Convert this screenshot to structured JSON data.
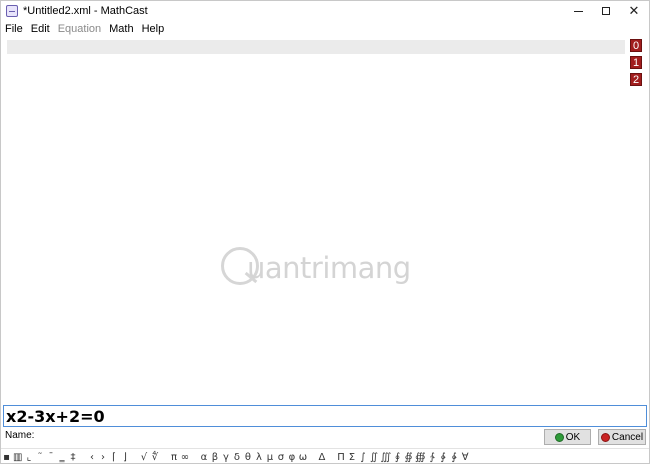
{
  "window": {
    "title": "*Untitled2.xml - MathCast",
    "controls": {
      "minimize_icon": "minimize-icon",
      "maximize_icon": "maximize-icon",
      "close_icon": "close-icon"
    }
  },
  "menubar": {
    "items": [
      {
        "label": "File",
        "enabled": true
      },
      {
        "label": "Edit",
        "enabled": true
      },
      {
        "label": "Equation",
        "enabled": false
      },
      {
        "label": "Math",
        "enabled": true
      },
      {
        "label": "Help",
        "enabled": true
      }
    ]
  },
  "canvas": {
    "line_numbers": [
      "0",
      "1",
      "2"
    ],
    "badge_color": "#a11d1d",
    "watermark_text": "uantrimang"
  },
  "editor": {
    "equation_value": "x2-3x+2=0",
    "name_label": "Name:",
    "ok_label": "OK",
    "cancel_label": "Cancel",
    "accent_color": "#4f8ed9"
  },
  "symbol_bar": {
    "symbols": [
      "▪",
      "▥",
      "⌞",
      "˜",
      "¯",
      "‗",
      "‡",
      "",
      "‹",
      "›",
      "⌈",
      "⌋",
      "",
      "√",
      "∜",
      "",
      "π",
      "∞",
      "",
      "α",
      "β",
      "γ",
      "δ",
      "θ",
      "λ",
      "μ",
      "σ",
      "φ",
      "ω",
      "",
      "Δ",
      "",
      "Π",
      "Σ",
      "∫",
      "∬",
      "∭",
      "∮",
      "∯",
      "∰",
      "∱",
      "∲",
      "∳",
      "∀"
    ]
  }
}
